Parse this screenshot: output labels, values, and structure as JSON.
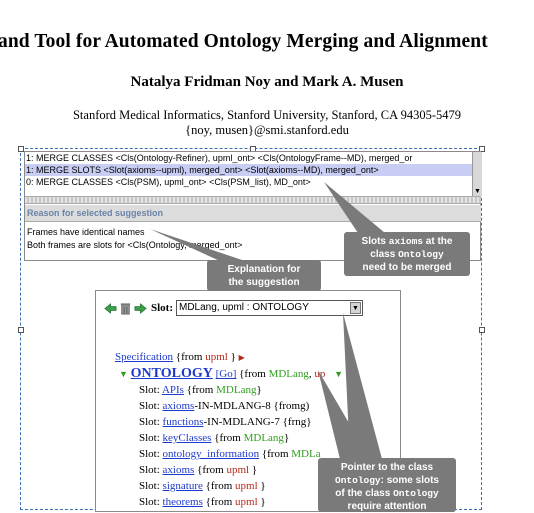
{
  "paper": {
    "title": "and Tool for Automated Ontology Merging and Alignment",
    "authors": "Natalya Fridman Noy and Mark A. Musen",
    "affiliation": "Stanford Medical Informatics, Stanford University, Stanford, CA 94305-5479",
    "emails": "{noy, musen}@smi.stanford.edu"
  },
  "suggestions": [
    "1: MERGE CLASSES <Cls(Ontology-Refiner), upml_ont> <Cls(OntologyFrame--MD), merged_or",
    "1: MERGE SLOTS <Slot(axioms--upml), merged_ont> <Slot(axioms--MD), merged_ont>",
    "0: MERGE CLASSES <Cls(PSM), upml_ont> <Cls(PSM_list), MD_ont>"
  ],
  "reason_header": "Reason for selected suggestion",
  "reasons": [
    "Frames have identical names",
    "Both frames are slots for <Cls(Ontology, merged_ont>"
  ],
  "callouts": {
    "explanation": [
      "Explanation for",
      "the suggestion"
    ],
    "slots": {
      "line1_pre": "Slots ",
      "line1_mono": "axioms",
      "line1_post": " at the",
      "line2_pre": "class ",
      "line2_mono": "Ontology",
      "line3": "need to be merged"
    },
    "pointer": {
      "line1": "Pointer to the class",
      "line2_mono": "Ontology",
      "line2_post": ": some slots",
      "line3_pre": "of the class ",
      "line3_mono": "Ontology",
      "line4": "require attention"
    }
  },
  "browser": {
    "slot_label": "Slot:",
    "slot_value": "MDLang, upml : ONTOLOGY",
    "spec": {
      "name": "Specification",
      "from": " {from ",
      "src": "upml",
      "close": " }"
    },
    "ontology": {
      "name": "ONTOLOGY",
      "go": "[Go]",
      "from": " {from ",
      "src1": "MDLang",
      "sep": ", ",
      "src2": "up"
    },
    "slots": [
      {
        "prefix": "Slot: ",
        "name": "APIs",
        "link": true,
        "tail": " {from ",
        "src": "MDLang",
        "srccolor": "green",
        "end": "}"
      },
      {
        "prefix": "Slot: ",
        "name": "axioms",
        "link": true,
        "mid": "-IN-MDLANG-8 {from",
        "tail": "",
        "src": "",
        "srccolor": "green",
        "end": "g)"
      },
      {
        "prefix": "Slot: ",
        "name": "functions",
        "link": true,
        "mid": "-IN-MDLANG-7 {fr",
        "tail": "",
        "src": "",
        "srccolor": "green",
        "end": "ng}"
      },
      {
        "prefix": "Slot: ",
        "name": "keyClasses",
        "link": true,
        "tail": " {from ",
        "src": "MDLang",
        "srccolor": "green",
        "end": "}"
      },
      {
        "prefix": "Slot: ",
        "name": "ontology_information",
        "link": true,
        "tail": " {from ",
        "src": "MDLa",
        "srccolor": "green",
        "end": ""
      },
      {
        "prefix": "Slot: ",
        "name": "axioms",
        "link": true,
        "tail": " {from ",
        "src": "upml",
        "srccolor": "red",
        "end": " }"
      },
      {
        "prefix": "Slot: ",
        "name": "signature",
        "link": true,
        "tail": " {from ",
        "src": "upml",
        "srccolor": "red",
        "end": " }"
      },
      {
        "prefix": "Slot: ",
        "name": "theorems",
        "link": true,
        "tail": " {from ",
        "src": "upml",
        "srccolor": "red",
        "end": " }"
      }
    ]
  },
  "colors": {
    "selection": "#c7cdf3",
    "callout": "#7a7a7a",
    "link": "#1e3acc",
    "red": "#b52b1b",
    "green": "#2f9e1e"
  },
  "icons": [
    "go-forward-icon",
    "trash-icon",
    "go-back-icon"
  ]
}
